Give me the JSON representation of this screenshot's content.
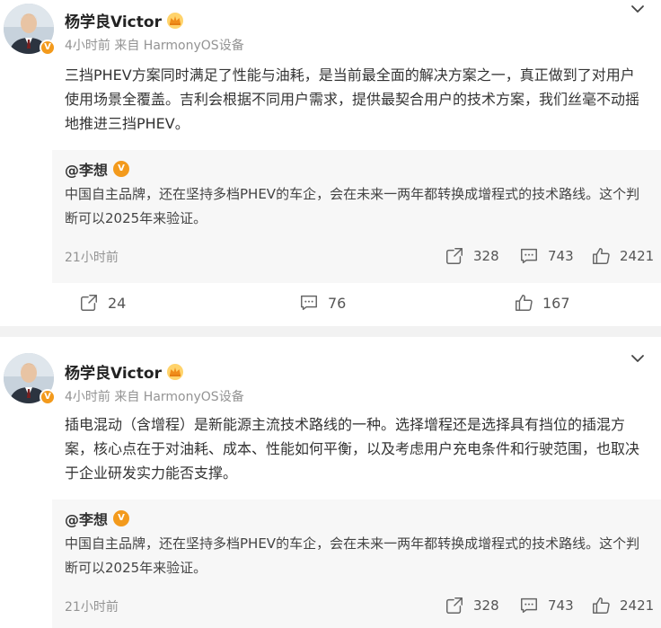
{
  "posts": [
    {
      "author": "杨学良Victor",
      "time_source": "4小时前  来自 HarmonyOS设备",
      "text": "三挡PHEV方案同时满足了性能与油耗，是当前最全面的解决方案之一，真正做到了对用户使用场景全覆盖。吉利会根据不同用户需求，提供最契合用户的技术方案，我们丝毫不动摇地推进三挡PHEV。",
      "quote": {
        "author": "@李想",
        "text": "中国自主品牌，还在坚持多档PHEV的车企，会在未来一两年都转换成增程式的技术路线。这个判断可以2025年来验证。",
        "time": "21小时前",
        "reposts": "328",
        "comments": "743",
        "likes": "2421"
      },
      "actions": {
        "reposts": "24",
        "comments": "76",
        "likes": "167"
      }
    },
    {
      "author": "杨学良Victor",
      "time_source": "4小时前  来自 HarmonyOS设备",
      "text": "插电混动（含增程）是新能源主流技术路线的一种。选择增程还是选择具有挡位的插混方案，核心点在于对油耗、成本、性能如何平衡，以及考虑用户充电条件和行驶范围，也取决于企业研发实力能否支撑。",
      "quote": {
        "author": "@李想",
        "text": "中国自主品牌，还在坚持多档PHEV的车企，会在未来一两年都转换成增程式的技术路线。这个判断可以2025年来验证。",
        "time": "21小时前",
        "reposts": "328",
        "comments": "743",
        "likes": "2421"
      }
    }
  ],
  "colors": {
    "accent": "#f39a1c",
    "meta": "#939393",
    "quote_bg": "#f7f7f7",
    "page_bg": "#f2f2f2"
  },
  "icons": [
    "chevron-down-icon",
    "crown-icon",
    "verified-icon",
    "repost-icon",
    "comment-icon",
    "like-icon"
  ]
}
